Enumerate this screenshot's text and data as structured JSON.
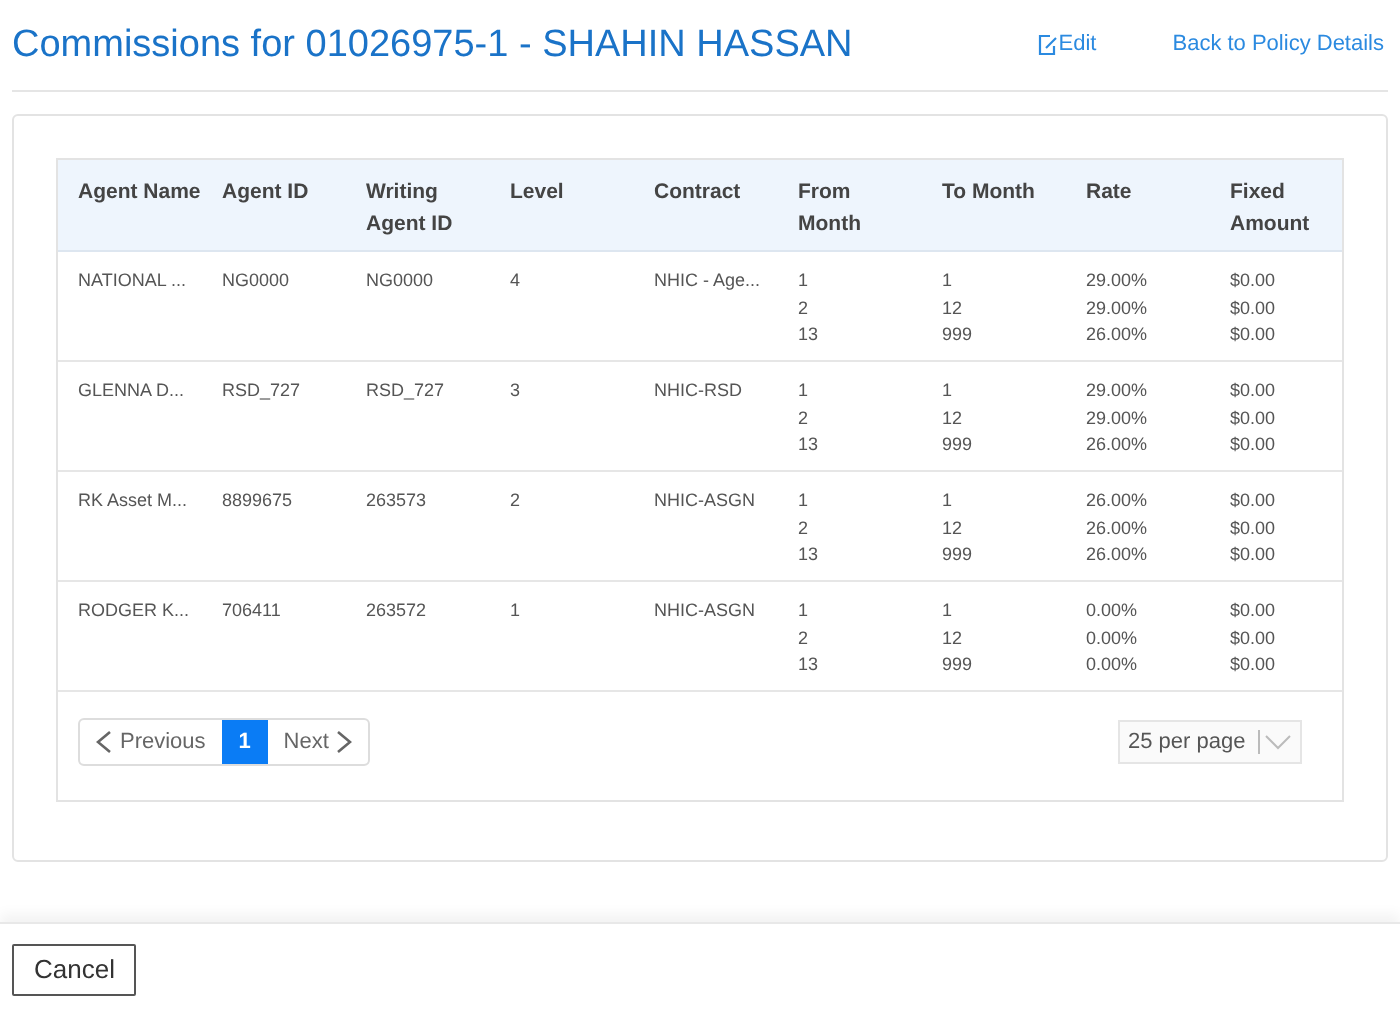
{
  "header": {
    "title": "Commissions for 01026975-1 - SHAHIN HASSAN",
    "edit_link": "Edit",
    "back_link": "Back to Policy Details"
  },
  "table": {
    "columns": [
      "Agent Name",
      "Agent ID",
      "Writing Agent ID",
      "Level",
      "Contract",
      "From Month",
      "To Month",
      "Rate",
      "Fixed Amount"
    ],
    "rows": [
      {
        "agent_name": "NATIONAL ...",
        "agent_id": "NG0000",
        "writing_agent_id": "NG0000",
        "level": "4",
        "contract": "NHIC - Age...",
        "tiers": [
          {
            "from": "1",
            "to": "1",
            "rate": "29.00%",
            "fixed": "$0.00"
          },
          {
            "from": "2",
            "to": "12",
            "rate": "29.00%",
            "fixed": "$0.00"
          },
          {
            "from": "13",
            "to": "999",
            "rate": "26.00%",
            "fixed": "$0.00"
          }
        ]
      },
      {
        "agent_name": "GLENNA D...",
        "agent_id": "RSD_727",
        "writing_agent_id": "RSD_727",
        "level": "3",
        "contract": "NHIC-RSD",
        "tiers": [
          {
            "from": "1",
            "to": "1",
            "rate": "29.00%",
            "fixed": "$0.00"
          },
          {
            "from": "2",
            "to": "12",
            "rate": "29.00%",
            "fixed": "$0.00"
          },
          {
            "from": "13",
            "to": "999",
            "rate": "26.00%",
            "fixed": "$0.00"
          }
        ]
      },
      {
        "agent_name": "RK Asset M...",
        "agent_id": "8899675",
        "writing_agent_id": "263573",
        "level": "2",
        "contract": "NHIC-ASGN",
        "tiers": [
          {
            "from": "1",
            "to": "1",
            "rate": "26.00%",
            "fixed": "$0.00"
          },
          {
            "from": "2",
            "to": "12",
            "rate": "26.00%",
            "fixed": "$0.00"
          },
          {
            "from": "13",
            "to": "999",
            "rate": "26.00%",
            "fixed": "$0.00"
          }
        ]
      },
      {
        "agent_name": "RODGER K...",
        "agent_id": "706411",
        "writing_agent_id": "263572",
        "level": "1",
        "contract": "NHIC-ASGN",
        "tiers": [
          {
            "from": "1",
            "to": "1",
            "rate": "0.00%",
            "fixed": "$0.00"
          },
          {
            "from": "2",
            "to": "12",
            "rate": "0.00%",
            "fixed": "$0.00"
          },
          {
            "from": "13",
            "to": "999",
            "rate": "0.00%",
            "fixed": "$0.00"
          }
        ]
      }
    ]
  },
  "pagination": {
    "previous": "Previous",
    "next": "Next",
    "pages": [
      {
        "label": "1",
        "selected": true
      }
    ],
    "page_size": "25 per page"
  },
  "footer": {
    "cancel": "Cancel"
  }
}
